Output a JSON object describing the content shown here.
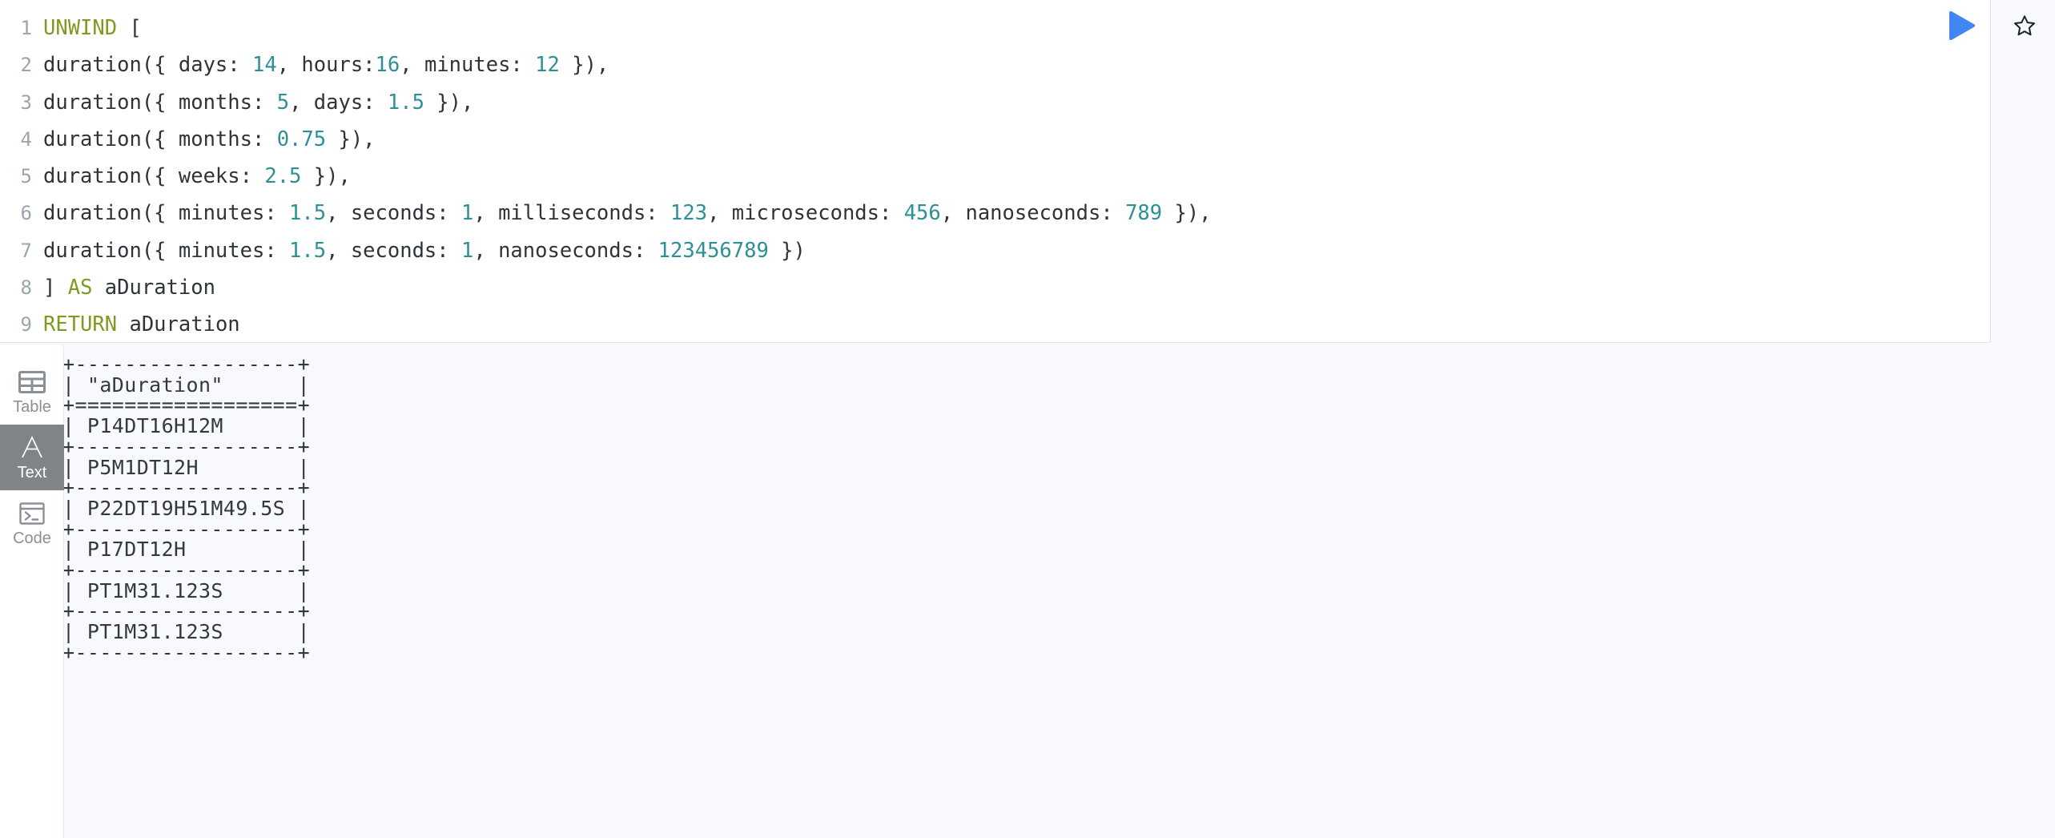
{
  "editor": {
    "language": "cypher",
    "run_button_label": "run-query",
    "favorite_button_label": "save-as-favorite",
    "accent_color": "#4286f4",
    "keyword_color": "#7d9b1f",
    "number_color": "#2d9097",
    "lines": [
      {
        "n": "1",
        "tokens": [
          {
            "t": "UNWIND",
            "c": "kw"
          },
          {
            "t": " [",
            "c": "plain"
          }
        ]
      },
      {
        "n": "2",
        "tokens": [
          {
            "t": "duration({ days: ",
            "c": "plain"
          },
          {
            "t": "14",
            "c": "num"
          },
          {
            "t": ", hours:",
            "c": "plain"
          },
          {
            "t": "16",
            "c": "num"
          },
          {
            "t": ", minutes: ",
            "c": "plain"
          },
          {
            "t": "12",
            "c": "num"
          },
          {
            "t": " }),",
            "c": "plain"
          }
        ]
      },
      {
        "n": "3",
        "tokens": [
          {
            "t": "duration({ months: ",
            "c": "plain"
          },
          {
            "t": "5",
            "c": "num"
          },
          {
            "t": ", days: ",
            "c": "plain"
          },
          {
            "t": "1.5",
            "c": "num"
          },
          {
            "t": " }),",
            "c": "plain"
          }
        ]
      },
      {
        "n": "4",
        "tokens": [
          {
            "t": "duration({ months: ",
            "c": "plain"
          },
          {
            "t": "0.75",
            "c": "num"
          },
          {
            "t": " }),",
            "c": "plain"
          }
        ]
      },
      {
        "n": "5",
        "tokens": [
          {
            "t": "duration({ weeks: ",
            "c": "plain"
          },
          {
            "t": "2.5",
            "c": "num"
          },
          {
            "t": " }),",
            "c": "plain"
          }
        ]
      },
      {
        "n": "6",
        "tokens": [
          {
            "t": "duration({ minutes: ",
            "c": "plain"
          },
          {
            "t": "1.5",
            "c": "num"
          },
          {
            "t": ", seconds: ",
            "c": "plain"
          },
          {
            "t": "1",
            "c": "num"
          },
          {
            "t": ", milliseconds: ",
            "c": "plain"
          },
          {
            "t": "123",
            "c": "num"
          },
          {
            "t": ", microseconds: ",
            "c": "plain"
          },
          {
            "t": "456",
            "c": "num"
          },
          {
            "t": ", nanoseconds: ",
            "c": "plain"
          },
          {
            "t": "789",
            "c": "num"
          },
          {
            "t": " }),",
            "c": "plain"
          }
        ]
      },
      {
        "n": "7",
        "tokens": [
          {
            "t": "duration({ minutes: ",
            "c": "plain"
          },
          {
            "t": "1.5",
            "c": "num"
          },
          {
            "t": ", seconds: ",
            "c": "plain"
          },
          {
            "t": "1",
            "c": "num"
          },
          {
            "t": ", nanoseconds: ",
            "c": "plain"
          },
          {
            "t": "123456789",
            "c": "num"
          },
          {
            "t": " })",
            "c": "plain"
          }
        ]
      },
      {
        "n": "8",
        "tokens": [
          {
            "t": "] ",
            "c": "plain"
          },
          {
            "t": "AS",
            "c": "kw"
          },
          {
            "t": " aDuration",
            "c": "plain"
          }
        ]
      },
      {
        "n": "9",
        "tokens": [
          {
            "t": "RETURN",
            "c": "kw"
          },
          {
            "t": " aDuration",
            "c": "plain"
          }
        ]
      }
    ]
  },
  "sidebar": {
    "items": [
      {
        "label": "Table",
        "icon": "table-icon",
        "active": false
      },
      {
        "label": "Text",
        "icon": "letter-a-icon",
        "active": true
      },
      {
        "label": "Code",
        "icon": "terminal-icon",
        "active": false
      }
    ],
    "active_background": "#808387"
  },
  "results": {
    "view": "Text",
    "column_header": "\"aDuration\"",
    "rows": [
      "P14DT16H12M",
      "P5M1DT12H",
      "P22DT19H51M49.5S",
      "P17DT12H",
      "PT1M31.123S",
      "PT1M31.123S"
    ],
    "ascii_table": "+------------------+\n| \"aDuration\"      |\n+==================+\n| P14DT16H12M      |\n+------------------+\n| P5M1DT12H        |\n+------------------+\n| P22DT19H51M49.5S |\n+------------------+\n| P17DT12H         |\n+------------------+\n| PT1M31.123S      |\n+------------------+\n| PT1M31.123S      |\n+------------------+"
  }
}
